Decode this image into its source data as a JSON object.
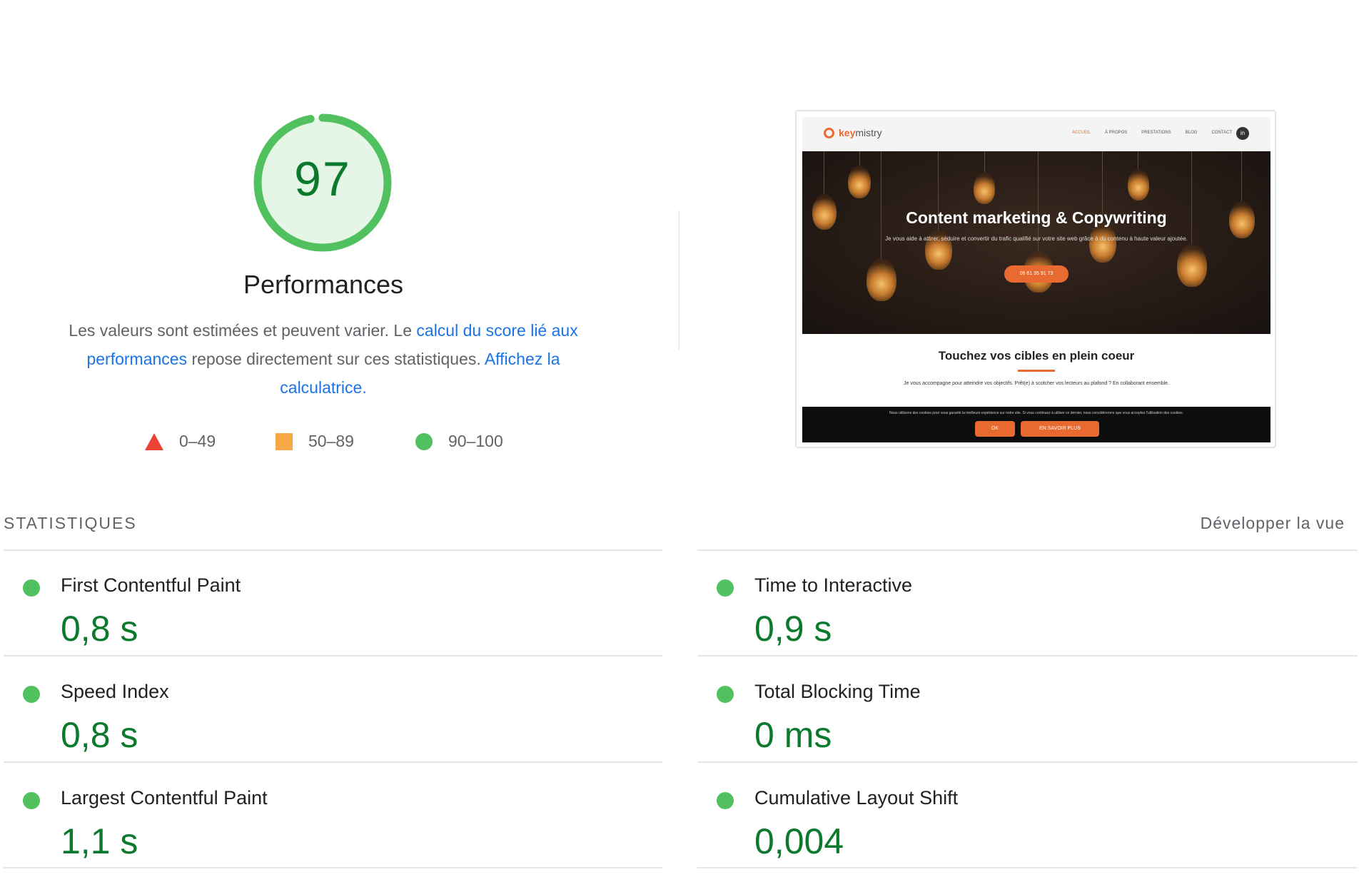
{
  "gauge": {
    "score": "97",
    "score_fraction": 0.97,
    "color": "#50c15e",
    "track_color": "#e5f6e7",
    "text_color": "#0c7a2d"
  },
  "performance": {
    "title": "Performances",
    "desc_part1": "Les valeurs sont estimées et peuvent varier. Le ",
    "link_score": "calcul du score lié aux performances",
    "desc_part2": " repose directement sur ces statistiques. ",
    "link_calc": "Affichez la calculatrice."
  },
  "legend": [
    {
      "icon": "triangle-red",
      "range": "0–49",
      "color": "#eb4335"
    },
    {
      "icon": "square-orange",
      "range": "50–89",
      "color": "#f5a843"
    },
    {
      "icon": "circle-green",
      "range": "90–100",
      "color": "#50c15e"
    }
  ],
  "screenshot": {
    "logo_key": "key",
    "logo_rest": "mistry",
    "nav": [
      "ACCUEIL",
      "À PROPOS",
      "PRESTATIONS",
      "BLOG",
      "CONTACT"
    ],
    "linkedin": "in",
    "hero_title": "Content marketing & Copywriting",
    "hero_sub": "Je vous aide à attirer, séduire et convertir du trafic qualifié sur votre site web grâce à du contenu à haute valeur ajoutée.",
    "hero_btn": "06 61 35 91 73",
    "h2": "Touchez vos cibles en plein coeur",
    "paragraph": "Je vous accompagne pour atteindre vos objectifs. Prêt(e) à scotcher vos lecteurs au plafond ? En collaborant ensemble.",
    "cookie_text": "Nous utilisons des cookies pour vous garantir la meilleure expérience sur notre site. Si vous continuez à utiliser ce dernier, nous considérerons que vous acceptez l'utilisation des cookies.",
    "cookie_ok": "OK",
    "cookie_more": "EN SAVOIR PLUS",
    "accent": "#e86a30"
  },
  "stats": {
    "header": "STATISTIQUES",
    "expand": "Développer la vue",
    "metrics": [
      {
        "label": "First Contentful Paint",
        "value": "0,8 s",
        "status": "good"
      },
      {
        "label": "Time to Interactive",
        "value": "0,9 s",
        "status": "good"
      },
      {
        "label": "Speed Index",
        "value": "0,8 s",
        "status": "good"
      },
      {
        "label": "Total Blocking Time",
        "value": "0 ms",
        "status": "good"
      },
      {
        "label": "Largest Contentful Paint",
        "value": "1,1 s",
        "status": "good"
      },
      {
        "label": "Cumulative Layout Shift",
        "value": "0,004",
        "status": "good"
      }
    ]
  }
}
